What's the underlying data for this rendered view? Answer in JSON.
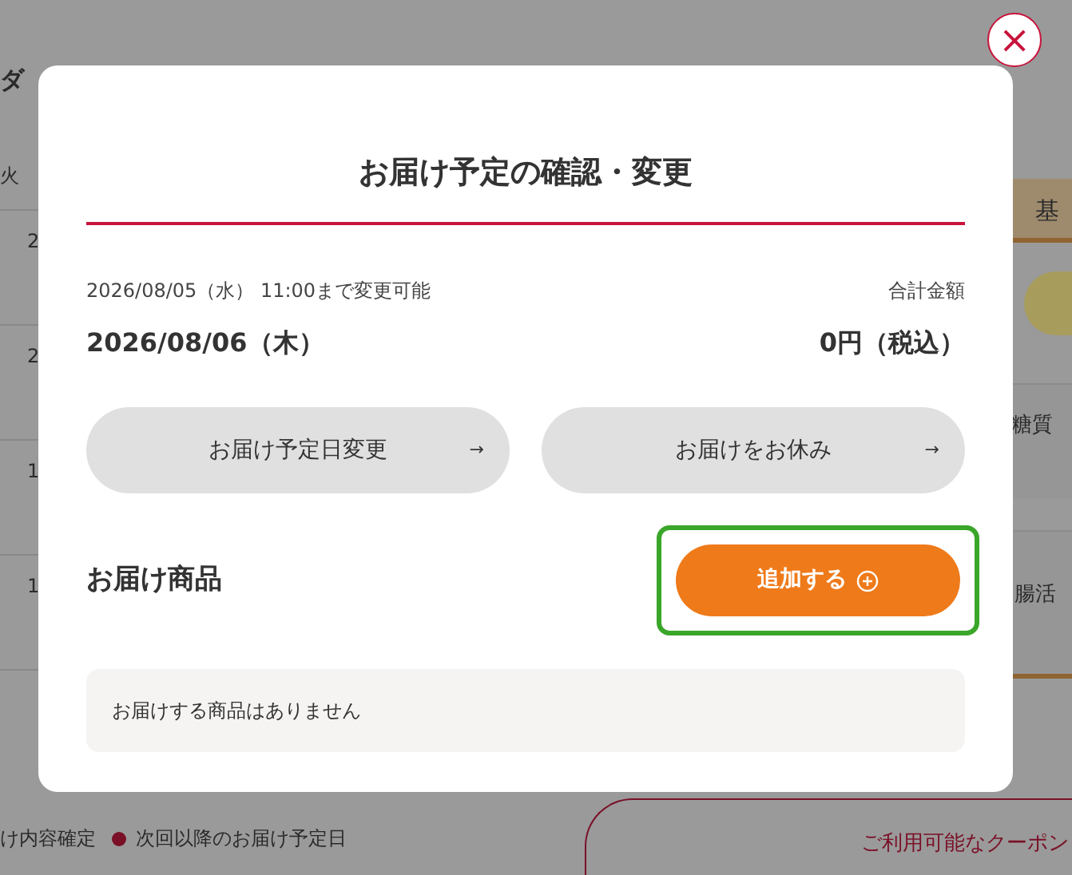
{
  "background": {
    "heading": "ダ",
    "weekday": "火",
    "dates": [
      "2",
      "2",
      "1",
      "1"
    ],
    "tab": "基",
    "items": [
      "糖質",
      "腸活"
    ],
    "legend": [
      "け内容確定",
      "次回以降のお届け予定日"
    ],
    "coupon_link": "ご利用可能なクーポン"
  },
  "dialog": {
    "close": "×",
    "title": "お届け予定の確認・変更",
    "deadline": "2026/08/05（水） 11:00まで変更可能",
    "total_label": "合計金額",
    "date": "2026/08/06（木）",
    "total": "0円（税込）",
    "actions": [
      {
        "label": "お届け予定日変更",
        "arrow": "→"
      },
      {
        "label": "お届けをお休み",
        "arrow": "→"
      }
    ],
    "section_title": "お届け商品",
    "add_button": {
      "label": "追加する",
      "highlighted": true
    },
    "empty_message": "お届けする商品はありません"
  }
}
